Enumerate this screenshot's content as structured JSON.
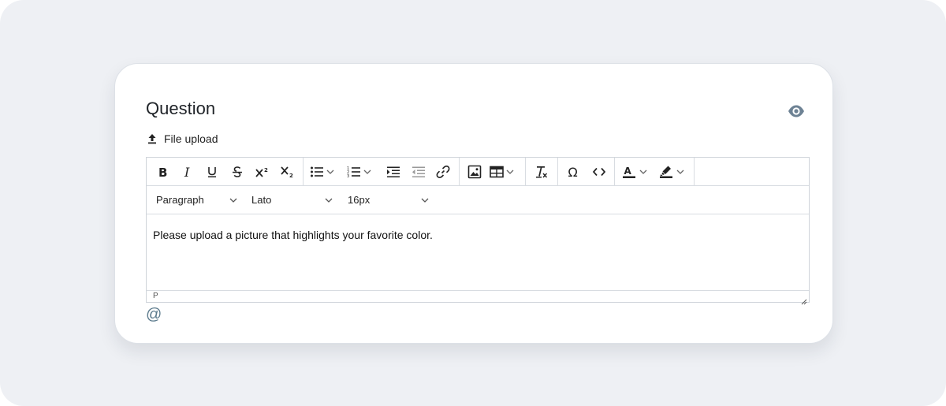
{
  "question": {
    "title": "Question",
    "file_upload_label": "File upload",
    "preview_icon": "eye-icon"
  },
  "toolbar": {
    "groups": [
      [
        "bold-icon",
        "italic-icon",
        "underline-icon",
        "strikethrough-icon",
        "superscript-icon",
        "subscript-icon"
      ],
      [
        "bullet-list-icon",
        "numbered-list-icon",
        "indent-icon",
        "outdent-icon",
        "link-icon"
      ],
      [
        "image-icon",
        "table-icon"
      ],
      [
        "clear-formatting-icon"
      ],
      [
        "special-character-icon",
        "code-view-icon"
      ],
      [
        "text-color-icon",
        "highlight-color-icon"
      ]
    ]
  },
  "formatbar": {
    "block_format": "Paragraph",
    "font_family": "Lato",
    "font_size": "16px"
  },
  "editor": {
    "content": "Please upload a picture that highlights your favorite color.",
    "element_path": "P"
  },
  "mention_symbol": "@",
  "colors": {
    "page_background": "#eef0f4",
    "card_background": "#ffffff",
    "border": "#cfd4da",
    "icon": "#222222",
    "muted_icon": "#6d8294",
    "mention": "#5b7a8c"
  }
}
